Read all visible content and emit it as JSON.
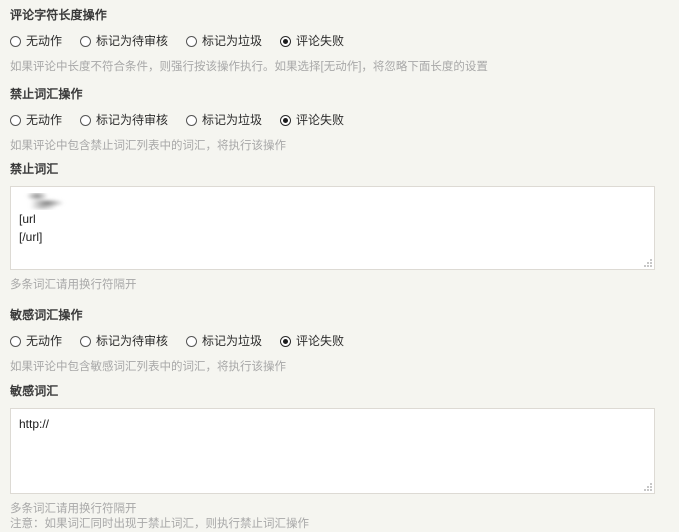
{
  "sections": [
    {
      "title": "评论字符长度操作",
      "options": [
        {
          "label": "无动作",
          "checked": false
        },
        {
          "label": "标记为待审核",
          "checked": false
        },
        {
          "label": "标记为垃圾",
          "checked": false
        },
        {
          "label": "评论失败",
          "checked": true
        }
      ],
      "help": "如果评论中长度不符合条件，则强行按该操作执行。如果选择[无动作]，将忽略下面长度的设置"
    },
    {
      "title": "禁止词汇操作",
      "options": [
        {
          "label": "无动作",
          "checked": false
        },
        {
          "label": "标记为待审核",
          "checked": false
        },
        {
          "label": "标记为垃圾",
          "checked": false
        },
        {
          "label": "评论失败",
          "checked": true
        }
      ],
      "help": "如果评论中包含禁止词汇列表中的词汇，将执行该操作"
    },
    {
      "title": "敏感词汇操作",
      "options": [
        {
          "label": "无动作",
          "checked": false
        },
        {
          "label": "标记为待审核",
          "checked": false
        },
        {
          "label": "标记为垃圾",
          "checked": false
        },
        {
          "label": "评论失败",
          "checked": true
        }
      ],
      "help": "如果评论中包含敏感词汇列表中的词汇，将执行该操作"
    }
  ],
  "banned_words": {
    "title": "禁止词汇",
    "redacted_line": "",
    "lines": [
      "[url",
      "[/url]"
    ],
    "note": "多条词汇请用换行符隔开"
  },
  "sensitive_words": {
    "title": "敏感词汇",
    "value": "http://",
    "note": "多条词汇请用换行符隔开",
    "warning": "注意：如果词汇同时出现于禁止词汇，则执行禁止词汇操作"
  },
  "colors": {
    "background": "#f5f5f0",
    "heading": "#3a3a3a",
    "help": "#a8a8a8",
    "field_border": "#dddad4",
    "field_background": "#ffffff",
    "radio_selected": "#1c1c1c"
  },
  "icons": {
    "resize_handle": "resize-grip-icon",
    "radio_unchecked": "radio-unchecked-icon",
    "radio_checked": "radio-checked-icon"
  }
}
